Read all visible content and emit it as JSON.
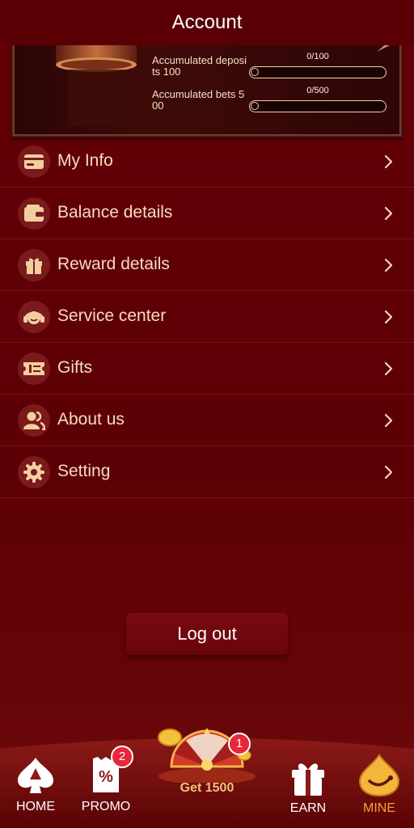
{
  "header": {
    "title": "Account"
  },
  "vip": {
    "rows": [
      {
        "label": "Accumulated deposits 100",
        "count": "0/100",
        "progress": 0
      },
      {
        "label": "Accumulated bets 500",
        "count": "0/500",
        "progress": 0
      }
    ]
  },
  "menu": {
    "items": [
      {
        "label": "My Info",
        "icon": "id-card-icon"
      },
      {
        "label": "Balance details",
        "icon": "wallet-icon"
      },
      {
        "label": "Reward details",
        "icon": "gift-box-icon"
      },
      {
        "label": "Service center",
        "icon": "headset-icon"
      },
      {
        "label": "Gifts",
        "icon": "ticket-icon"
      },
      {
        "label": "About us",
        "icon": "users-icon"
      },
      {
        "label": "Setting",
        "icon": "gear-icon"
      }
    ]
  },
  "logout": {
    "label": "Log out"
  },
  "nav": {
    "home": "HOME",
    "promo": "PROMO",
    "promo_badge": "2",
    "center": "Get 1500",
    "center_badge": "1",
    "earn": "EARN",
    "mine": "MINE"
  },
  "colors": {
    "background": "#5e0005",
    "text": "#f7dcbf",
    "active_tab": "#f0a23a",
    "badge": "#e8273b"
  }
}
